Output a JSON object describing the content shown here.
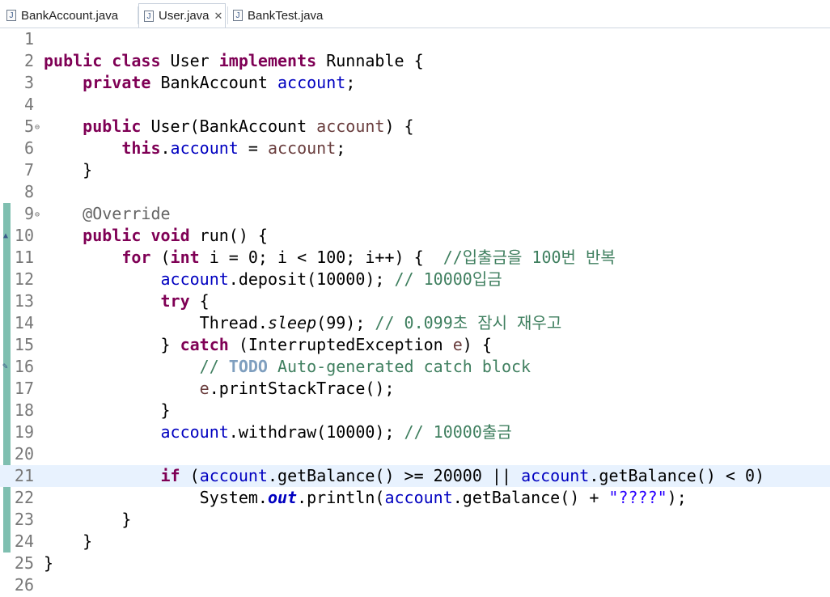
{
  "tabs": [
    {
      "label": "BankAccount.java",
      "icon": "java-file-icon",
      "active": false
    },
    {
      "label": "User.java",
      "icon": "java-file-icon",
      "active": true,
      "close": "✕"
    },
    {
      "label": "BankTest.java",
      "icon": "java-file-icon",
      "active": false
    }
  ],
  "editor": {
    "current_line": 21,
    "line_numbers": [
      "1",
      "2",
      "3",
      "4",
      "5",
      "6",
      "7",
      "8",
      "9",
      "10",
      "11",
      "12",
      "13",
      "14",
      "15",
      "16",
      "17",
      "18",
      "19",
      "20",
      "21",
      "22",
      "23",
      "24",
      "25",
      "26"
    ],
    "lines": [
      [],
      [
        {
          "t": "public",
          "c": "kw"
        },
        {
          "t": " "
        },
        {
          "t": "class",
          "c": "kw"
        },
        {
          "t": " User "
        },
        {
          "t": "implements",
          "c": "kw"
        },
        {
          "t": " Runnable {"
        }
      ],
      [
        {
          "t": "    "
        },
        {
          "t": "private",
          "c": "kw"
        },
        {
          "t": " BankAccount "
        },
        {
          "t": "account",
          "c": "fld"
        },
        {
          "t": ";"
        }
      ],
      [],
      [
        {
          "t": "    "
        },
        {
          "t": "public",
          "c": "kw"
        },
        {
          "t": " User(BankAccount "
        },
        {
          "t": "account",
          "c": "prm"
        },
        {
          "t": ") {"
        }
      ],
      [
        {
          "t": "        "
        },
        {
          "t": "this",
          "c": "kw"
        },
        {
          "t": "."
        },
        {
          "t": "account",
          "c": "fld"
        },
        {
          "t": " = "
        },
        {
          "t": "account",
          "c": "prm"
        },
        {
          "t": ";"
        }
      ],
      [
        {
          "t": "    }"
        }
      ],
      [],
      [
        {
          "t": "    "
        },
        {
          "t": "@Override",
          "c": "ann"
        }
      ],
      [
        {
          "t": "    "
        },
        {
          "t": "public",
          "c": "kw"
        },
        {
          "t": " "
        },
        {
          "t": "void",
          "c": "kw"
        },
        {
          "t": " run() {"
        }
      ],
      [
        {
          "t": "        "
        },
        {
          "t": "for",
          "c": "kw"
        },
        {
          "t": " ("
        },
        {
          "t": "int",
          "c": "kw"
        },
        {
          "t": " i = 0; i < 100; i++) {  "
        },
        {
          "t": "//입출금을 100번 반복",
          "c": "cmt"
        }
      ],
      [
        {
          "t": "            "
        },
        {
          "t": "account",
          "c": "fld"
        },
        {
          "t": ".deposit(10000); "
        },
        {
          "t": "// 10000입금",
          "c": "cmt"
        }
      ],
      [
        {
          "t": "            "
        },
        {
          "t": "try",
          "c": "kw"
        },
        {
          "t": " {"
        }
      ],
      [
        {
          "t": "                Thread."
        },
        {
          "t": "sleep",
          "c": "ital"
        },
        {
          "t": "(99); "
        },
        {
          "t": "// 0.099초 잠시 재우고",
          "c": "cmt"
        }
      ],
      [
        {
          "t": "            } "
        },
        {
          "t": "catch",
          "c": "kw"
        },
        {
          "t": " (InterruptedException "
        },
        {
          "t": "e",
          "c": "prm"
        },
        {
          "t": ") {"
        }
      ],
      [
        {
          "t": "                "
        },
        {
          "t": "// ",
          "c": "cmt"
        },
        {
          "t": "TODO",
          "c": "todo"
        },
        {
          "t": " Auto-generated catch block",
          "c": "cmt"
        }
      ],
      [
        {
          "t": "                "
        },
        {
          "t": "e",
          "c": "prm"
        },
        {
          "t": ".printStackTrace();"
        }
      ],
      [
        {
          "t": "            }"
        }
      ],
      [
        {
          "t": "            "
        },
        {
          "t": "account",
          "c": "fld"
        },
        {
          "t": ".withdraw(10000); "
        },
        {
          "t": "// 10000출금",
          "c": "cmt"
        }
      ],
      [],
      [
        {
          "t": "            "
        },
        {
          "t": "if",
          "c": "kw"
        },
        {
          "t": " ("
        },
        {
          "t": "account",
          "c": "fld"
        },
        {
          "t": ".getBalance() >= 20000 || "
        },
        {
          "t": "account",
          "c": "fld"
        },
        {
          "t": ".getBalance() < 0)"
        }
      ],
      [
        {
          "t": "                System."
        },
        {
          "t": "out",
          "c": "sfld"
        },
        {
          "t": ".println("
        },
        {
          "t": "account",
          "c": "fld"
        },
        {
          "t": ".getBalance() + "
        },
        {
          "t": "\"????\"",
          "c": "str"
        },
        {
          "t": ");"
        }
      ],
      [
        {
          "t": "        }"
        }
      ],
      [
        {
          "t": "    }"
        }
      ],
      [
        {
          "t": "}"
        }
      ],
      []
    ],
    "fold_lines": [
      5,
      9
    ],
    "override_marker_line": 10,
    "task_marker_line": 16,
    "fold_glyph": "⊖",
    "override_glyph": "▲",
    "task_glyph": "✎"
  }
}
